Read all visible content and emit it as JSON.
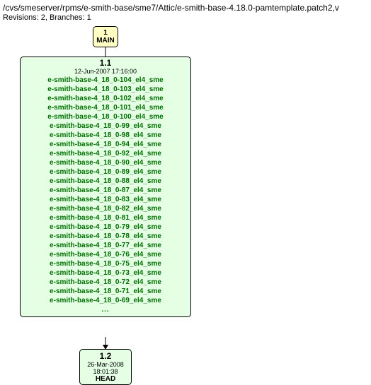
{
  "header": {
    "path": "/cvs/smeserver/rpms/e-smith-base/sme7/Attic/e-smith-base-4.18.0-pamtemplate.patch2,v",
    "subhead": "Revisions: 2, Branches: 1"
  },
  "branch": {
    "num": "1",
    "label": "MAIN"
  },
  "rev1": {
    "num": "1.1",
    "date": "12-Jun-2007 17:16:00",
    "tags": [
      "e-smith-base-4_18_0-104_el4_sme",
      "e-smith-base-4_18_0-103_el4_sme",
      "e-smith-base-4_18_0-102_el4_sme",
      "e-smith-base-4_18_0-101_el4_sme",
      "e-smith-base-4_18_0-100_el4_sme",
      "e-smith-base-4_18_0-99_el4_sme",
      "e-smith-base-4_18_0-98_el4_sme",
      "e-smith-base-4_18_0-94_el4_sme",
      "e-smith-base-4_18_0-92_el4_sme",
      "e-smith-base-4_18_0-90_el4_sme",
      "e-smith-base-4_18_0-89_el4_sme",
      "e-smith-base-4_18_0-88_el4_sme",
      "e-smith-base-4_18_0-87_el4_sme",
      "e-smith-base-4_18_0-83_el4_sme",
      "e-smith-base-4_18_0-82_el4_sme",
      "e-smith-base-4_18_0-81_el4_sme",
      "e-smith-base-4_18_0-79_el4_sme",
      "e-smith-base-4_18_0-78_el4_sme",
      "e-smith-base-4_18_0-77_el4_sme",
      "e-smith-base-4_18_0-76_el4_sme",
      "e-smith-base-4_18_0-75_el4_sme",
      "e-smith-base-4_18_0-73_el4_sme",
      "e-smith-base-4_18_0-72_el4_sme",
      "e-smith-base-4_18_0-71_el4_sme",
      "e-smith-base-4_18_0-69_el4_sme"
    ],
    "ellipsis": "..."
  },
  "rev2": {
    "num": "1.2",
    "date": "26-Mar-2008 18:01:38",
    "label": "HEAD"
  }
}
